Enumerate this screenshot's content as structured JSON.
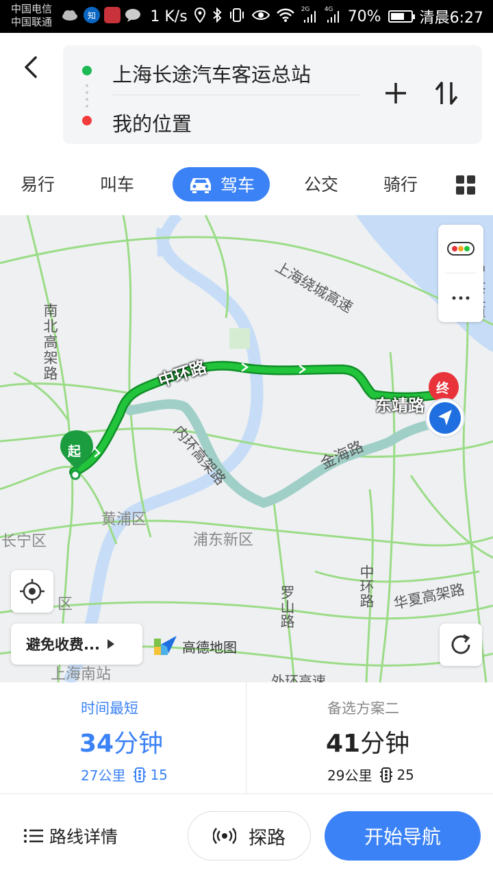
{
  "status_bar": {
    "carrier_1": "中国电信",
    "carrier_2": "中国联通",
    "speed": "1 K/s",
    "battery": "70%",
    "battery_level": 0.7,
    "time": "清晨6:27",
    "app_icons": [
      "cloud-icon",
      "zhihu-icon",
      "app-red-icon",
      "chat-icon"
    ],
    "zhihu_label": "知",
    "net_2g": "2G",
    "net_4g": "4G"
  },
  "route": {
    "start": "上海长途汽车客运总站",
    "end": "我的位置"
  },
  "tabs": [
    {
      "label": "易行"
    },
    {
      "label": "叫车"
    },
    {
      "label": "驾车",
      "active": true
    },
    {
      "label": "公交"
    },
    {
      "label": "骑行"
    }
  ],
  "map": {
    "labels": {
      "nanbei": "南北高架路",
      "zhonghuan_main": "中环路",
      "dongjing": "东靖路",
      "jinhai": "金海路",
      "neihuan": "内环高架路",
      "huangpu": "黄浦区",
      "pudong": "浦东新区",
      "changning": "长宁区",
      "luoshan": "罗山路",
      "zhonghuan_south": "中环路",
      "huaxia": "华夏高架路",
      "raocheng": "上海绕城高速",
      "waihuan": "外环高速",
      "shanghai_south": "上海南站",
      "district_left": "区",
      "right_edge": "沪长江道"
    },
    "markers": {
      "start": "起",
      "end": "终"
    },
    "avoid_button": "避免收费...",
    "logo": "高德地图",
    "colors": {
      "main_route": "#1fb83a",
      "alt_route": "#9fcfc7",
      "road": "#8fd67a",
      "water": "#c7ddf7"
    }
  },
  "plans": [
    {
      "label": "时间最短",
      "time_num": "34",
      "time_unit": "分钟",
      "distance": "27公里",
      "lights": "15",
      "color": "#3b82f6"
    },
    {
      "label": "备选方案二",
      "time_num": "41",
      "time_unit": "分钟",
      "distance": "29公里",
      "lights": "25",
      "color": "#222222"
    }
  ],
  "actions": {
    "details": "路线详情",
    "explore": "探路",
    "start_nav": "开始导航"
  }
}
